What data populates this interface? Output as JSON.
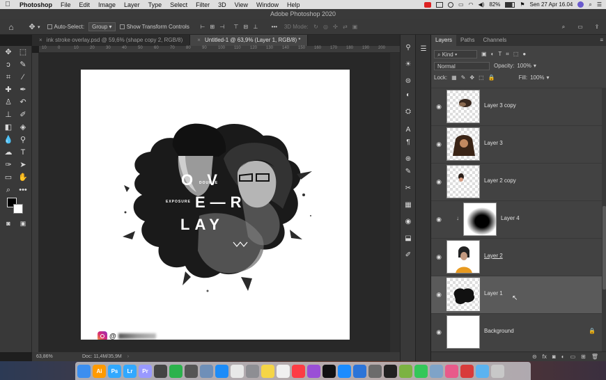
{
  "menubar": {
    "app_name": "Photoshop",
    "items": [
      "File",
      "Edit",
      "Image",
      "Layer",
      "Type",
      "Select",
      "Filter",
      "3D",
      "View",
      "Window",
      "Help"
    ],
    "battery": "82%",
    "datetime": "Sen 27 Apr  16.04"
  },
  "window": {
    "title": "Adobe Photoshop 2020"
  },
  "options": {
    "auto_select_label": "Auto-Select:",
    "auto_select_value": "Group",
    "show_transform_label": "Show Transform Controls",
    "mode_3d_label": "3D Mode:",
    "more_label": "•••"
  },
  "tabs": [
    {
      "label": "ink stroke overlay.psd @ 59,6% (shape copy 2, RGB/8)",
      "active": false
    },
    {
      "label": "Untitled-1 @ 63,9% (Layer 1, RGB/8) *",
      "active": true
    }
  ],
  "ruler": {
    "top_ticks": [
      "10",
      "0",
      "10",
      "20",
      "30",
      "40",
      "50",
      "60",
      "70",
      "80",
      "90",
      "100",
      "110",
      "120",
      "130",
      "140",
      "150",
      "160",
      "170",
      "180",
      "190",
      "200"
    ]
  },
  "artwork": {
    "line1": "O V",
    "double": "DOUBLE",
    "exposure": "EXPOSURE",
    "line2": "E—R",
    "line3": "LAY",
    "watermark_handle": "@"
  },
  "status": {
    "zoom": "63,86%",
    "doc": "Doc: 11,4M/35,9M"
  },
  "layers_panel": {
    "tabs": [
      "Layers",
      "Paths",
      "Channels"
    ],
    "kind_label": "Kind",
    "blend_mode": "Normal",
    "opacity_label": "Opacity:",
    "opacity_value": "100%",
    "lock_label": "Lock:",
    "fill_label": "Fill:",
    "fill_value": "100%",
    "layers": [
      {
        "name": "Layer 3 copy",
        "selected": false
      },
      {
        "name": "Layer 3",
        "selected": false
      },
      {
        "name": "Layer 2 copy",
        "selected": false
      },
      {
        "name": "Layer 4",
        "selected": false
      },
      {
        "name": "Layer 2",
        "selected": false
      },
      {
        "name": "Layer 1",
        "selected": true
      },
      {
        "name": "Background",
        "selected": false
      }
    ],
    "footer_icons": [
      "link-icon",
      "fx-icon",
      "mask-icon",
      "adjustment-icon",
      "group-icon",
      "new-layer-icon",
      "trash-icon"
    ]
  },
  "dock": {
    "apps": [
      {
        "name": "finder",
        "label": "",
        "color": "#3b8ef0"
      },
      {
        "name": "illustrator",
        "label": "Ai",
        "color": "#ff9a00"
      },
      {
        "name": "photoshop",
        "label": "Ps",
        "color": "#31a8ff"
      },
      {
        "name": "lightroom",
        "label": "Lr",
        "color": "#31a8ff"
      },
      {
        "name": "premiere",
        "label": "Pr",
        "color": "#9999ff"
      },
      {
        "name": "screen",
        "label": "",
        "color": "#444444"
      },
      {
        "name": "camtasia",
        "label": "",
        "color": "#2bb24c"
      },
      {
        "name": "app-dark",
        "label": "",
        "color": "#555555"
      },
      {
        "name": "preview",
        "label": "",
        "color": "#6f8fb8"
      },
      {
        "name": "safari",
        "label": "",
        "color": "#1d8cf8"
      },
      {
        "name": "chrome",
        "label": "",
        "color": "#e8e8e8"
      },
      {
        "name": "settings",
        "label": "",
        "color": "#8e8e93"
      },
      {
        "name": "notes",
        "label": "",
        "color": "#f5d547"
      },
      {
        "name": "photos",
        "label": "",
        "color": "#f0f0f0"
      },
      {
        "name": "music",
        "label": "",
        "color": "#fc3c44"
      },
      {
        "name": "podcasts",
        "label": "",
        "color": "#9a4fd6"
      },
      {
        "name": "apple-tv",
        "label": "",
        "color": "#111111"
      },
      {
        "name": "app-store",
        "label": "",
        "color": "#1a8cff"
      },
      {
        "name": "xcode",
        "label": "",
        "color": "#2c74d8"
      },
      {
        "name": "app-grey",
        "label": "",
        "color": "#6b6b6b"
      },
      {
        "name": "obs",
        "label": "",
        "color": "#222222"
      },
      {
        "name": "android",
        "label": "",
        "color": "#7cb342"
      },
      {
        "name": "messages",
        "label": "",
        "color": "#34c759"
      },
      {
        "name": "downloads",
        "label": "",
        "color": "#7fa3c8"
      },
      {
        "name": "app-pink",
        "label": "",
        "color": "#e85a8a"
      },
      {
        "name": "app-red",
        "label": "",
        "color": "#d83b3b"
      },
      {
        "name": "folder",
        "label": "",
        "color": "#5bb3f0"
      },
      {
        "name": "trash",
        "label": "",
        "color": "#c8c8c8"
      }
    ]
  }
}
